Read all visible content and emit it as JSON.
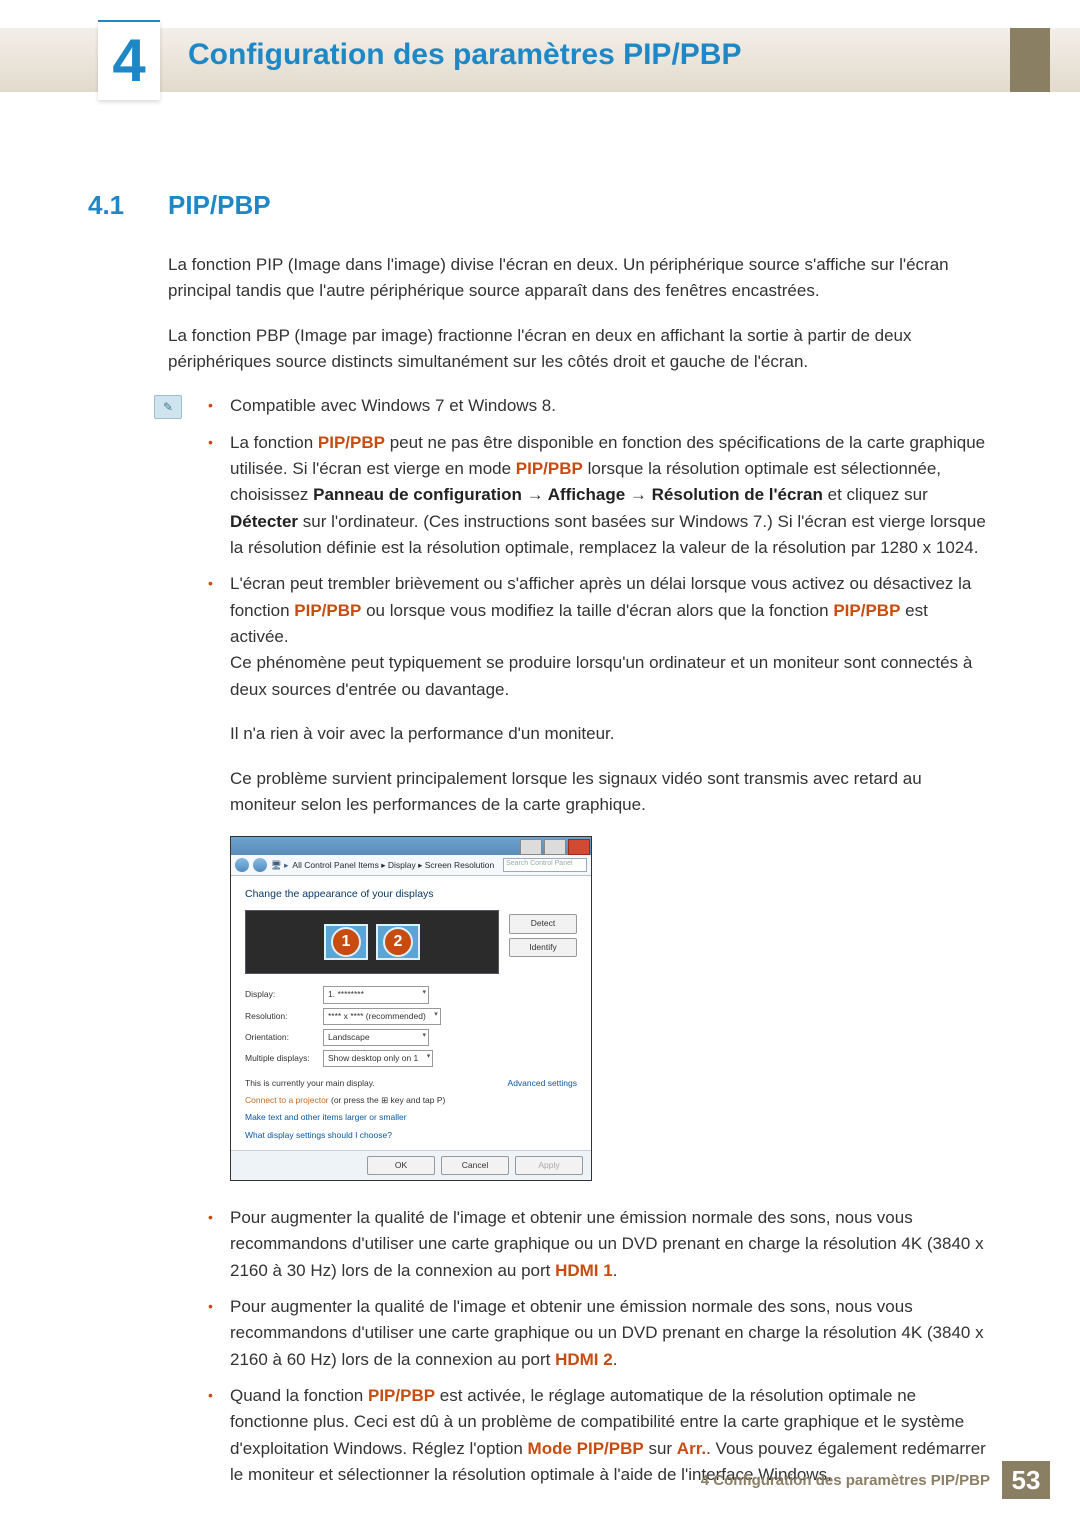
{
  "chapter": {
    "number": "4",
    "title": "Configuration des paramètres PIP/PBP"
  },
  "section": {
    "number": "4.1",
    "title": "PIP/PBP"
  },
  "intro": {
    "p1": "La fonction PIP (Image dans l'image) divise l'écran en deux. Un périphérique source s'affiche sur l'écran principal tandis que l'autre périphérique source apparaît dans des fenêtres encastrées.",
    "p2": "La fonction PBP (Image par image) fractionne l'écran en deux en affichant la sortie à partir de deux périphériques source distincts simultanément sur les côtés droit et gauche de l'écran."
  },
  "info": {
    "b1": "Compatible avec Windows 7 et Windows 8.",
    "b2": {
      "pre": "La fonction ",
      "pippbp": "PIP/PBP",
      "mid1": " peut ne pas être disponible en fonction des spécifications de la carte graphique utilisée. Si l'écran est vierge en mode ",
      "mid2": " lorsque la résolution optimale est sélectionnée, choisissez ",
      "cp": "Panneau de configuration",
      "arrow": " → ",
      "aff": "Affichage",
      "res": "Résolution de l'écran",
      "mid3": " et cliquez sur ",
      "det": "Détecter",
      "tail": " sur l'ordinateur. (Ces instructions sont basées sur Windows 7.) Si l'écran est vierge lorsque la résolution définie est la résolution optimale, remplacez la valeur de la résolution par 1280 x 1024."
    },
    "b3": {
      "pre": "L'écran peut trembler brièvement ou s'afficher après un délai lorsque vous activez ou désactivez la fonction ",
      "pippbp": "PIP/PBP",
      "mid": " ou lorsque vous modifiez la taille d'écran alors que la fonction ",
      "tail": " est activée.",
      "s1": "Ce phénomène peut typiquement se produire lorsqu'un ordinateur et un moniteur sont connectés à deux sources d'entrée ou davantage.",
      "s2": "Il n'a rien à voir avec la performance d'un moniteur.",
      "s3": "Ce problème survient principalement lorsque les signaux vidéo sont transmis avec retard au moniteur selon les performances de la carte graphique."
    },
    "b4": {
      "pre": "Pour augmenter la qualité de l'image et obtenir une émission normale des sons, nous vous recommandons d'utiliser une carte graphique ou un DVD prenant en charge la résolution 4K (3840 x 2160 à 30 Hz) lors de la connexion au port ",
      "port": "HDMI 1",
      "tail": "."
    },
    "b5": {
      "pre": "Pour augmenter la qualité de l'image et obtenir une émission normale des sons, nous vous recommandons d'utiliser une carte graphique ou un DVD prenant en charge la résolution 4K (3840 x 2160 à 60 Hz) lors de la connexion au port ",
      "port": "HDMI 2",
      "tail": "."
    },
    "b6": {
      "pre": "Quand la fonction ",
      "pippbp": "PIP/PBP",
      "mid1": " est activée, le réglage automatique de la résolution optimale ne fonctionne plus. Ceci est dû à un problème de compatibilité entre la carte graphique et le système d'exploitation Windows. Réglez l'option ",
      "mode": "Mode PIP/PBP",
      "mid2": " sur ",
      "arr": "Arr.",
      "tail": ". Vous pouvez également redémarrer le moniteur et sélectionner la résolution optimale à l'aide de l'interface Windows."
    }
  },
  "panel": {
    "breadcrumb": "All Control Panel Items  ▸  Display  ▸  Screen Resolution",
    "search_placeholder": "Search Control Panel",
    "heading": "Change the appearance of your displays",
    "monitor1": "1",
    "monitor2": "2",
    "detect": "Detect",
    "identify": "Identify",
    "labels": {
      "display": "Display:",
      "resolution": "Resolution:",
      "orientation": "Orientation:",
      "multiple": "Multiple displays:"
    },
    "values": {
      "display": "1. ********",
      "resolution": "**** x **** (recommended)",
      "orientation": "Landscape",
      "multiple": "Show desktop only on 1"
    },
    "main_msg": "This is currently your main display.",
    "adv": "Advanced settings",
    "link_proj_pre": "Connect to a projector",
    "link_proj_tail": " (or press the ⊞ key and tap P)",
    "link_larger": "Make text and other items larger or smaller",
    "link_what": "What display settings should I choose?",
    "ok": "OK",
    "cancel": "Cancel",
    "apply": "Apply"
  },
  "footer": {
    "text": "4 Configuration des paramètres PIP/PBP",
    "page": "53"
  }
}
